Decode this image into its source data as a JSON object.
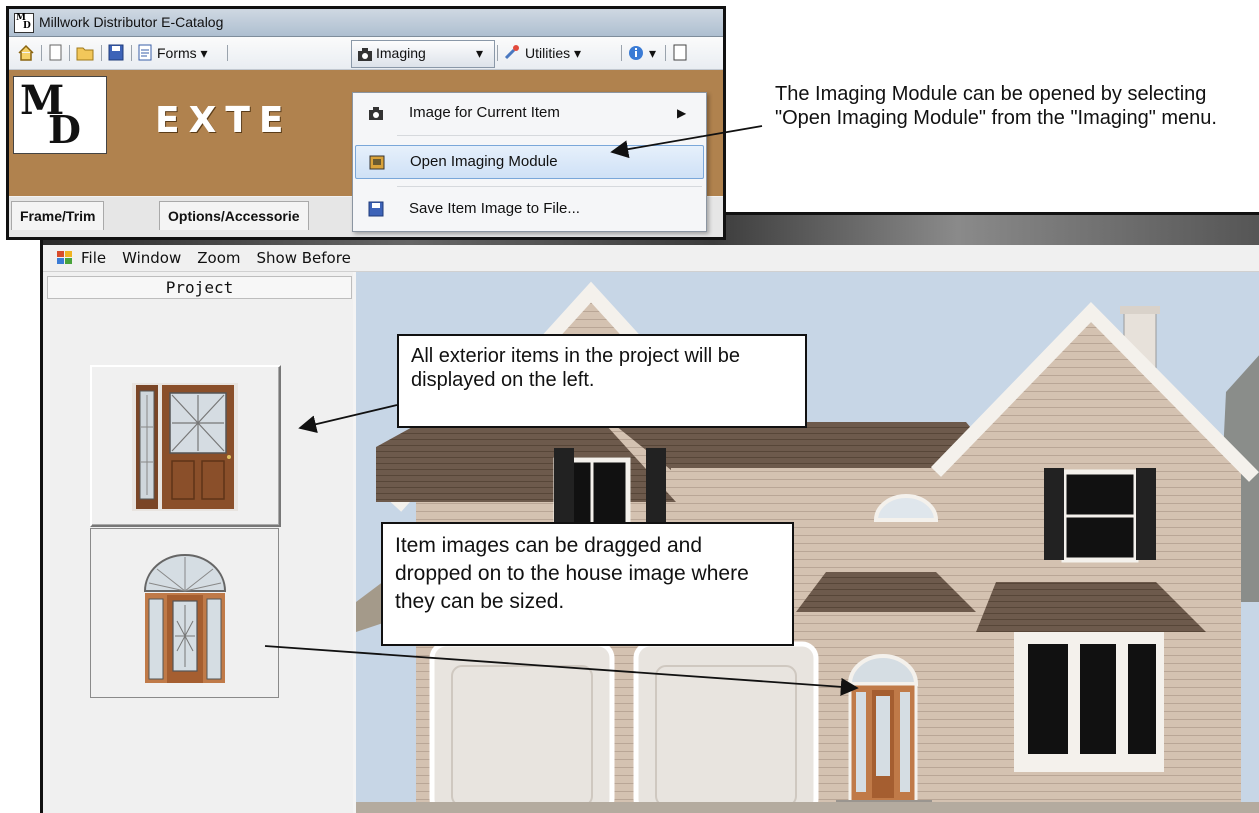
{
  "catalog": {
    "title": "Millwork Distributor E-Catalog",
    "logo_m": "M",
    "logo_d": "D",
    "toolbar": {
      "forms": "Forms",
      "imaging": "Imaging",
      "utilities": "Utilities"
    },
    "banner": "EXTE",
    "tabs": [
      "Frame/Trim",
      "Options/Accessorie"
    ],
    "imaging_menu": {
      "image_current": "Image for Current Item",
      "open_module": "Open Imaging Module",
      "save_image": "Save Item Image to File..."
    }
  },
  "imaging": {
    "menu": [
      "File",
      "Window",
      "Zoom",
      "Show Before"
    ],
    "project_header": "Project"
  },
  "annotations": {
    "open_module": "The Imaging Module can be opened by selecting \"Open Imaging Module\" from the \"Imaging\" menu.",
    "left_items": "All exterior items in the project will be displayed on the left.",
    "drag_drop": "Item images can be dragged and dropped on to the house image where they can be sized."
  },
  "colors": {
    "brand_strip": "#b0824e",
    "door_wood": "#8a4f2a",
    "siding": "#d6c4b4",
    "roof": "#6e5a4a",
    "menu_highlight": "#cfe1f6"
  }
}
